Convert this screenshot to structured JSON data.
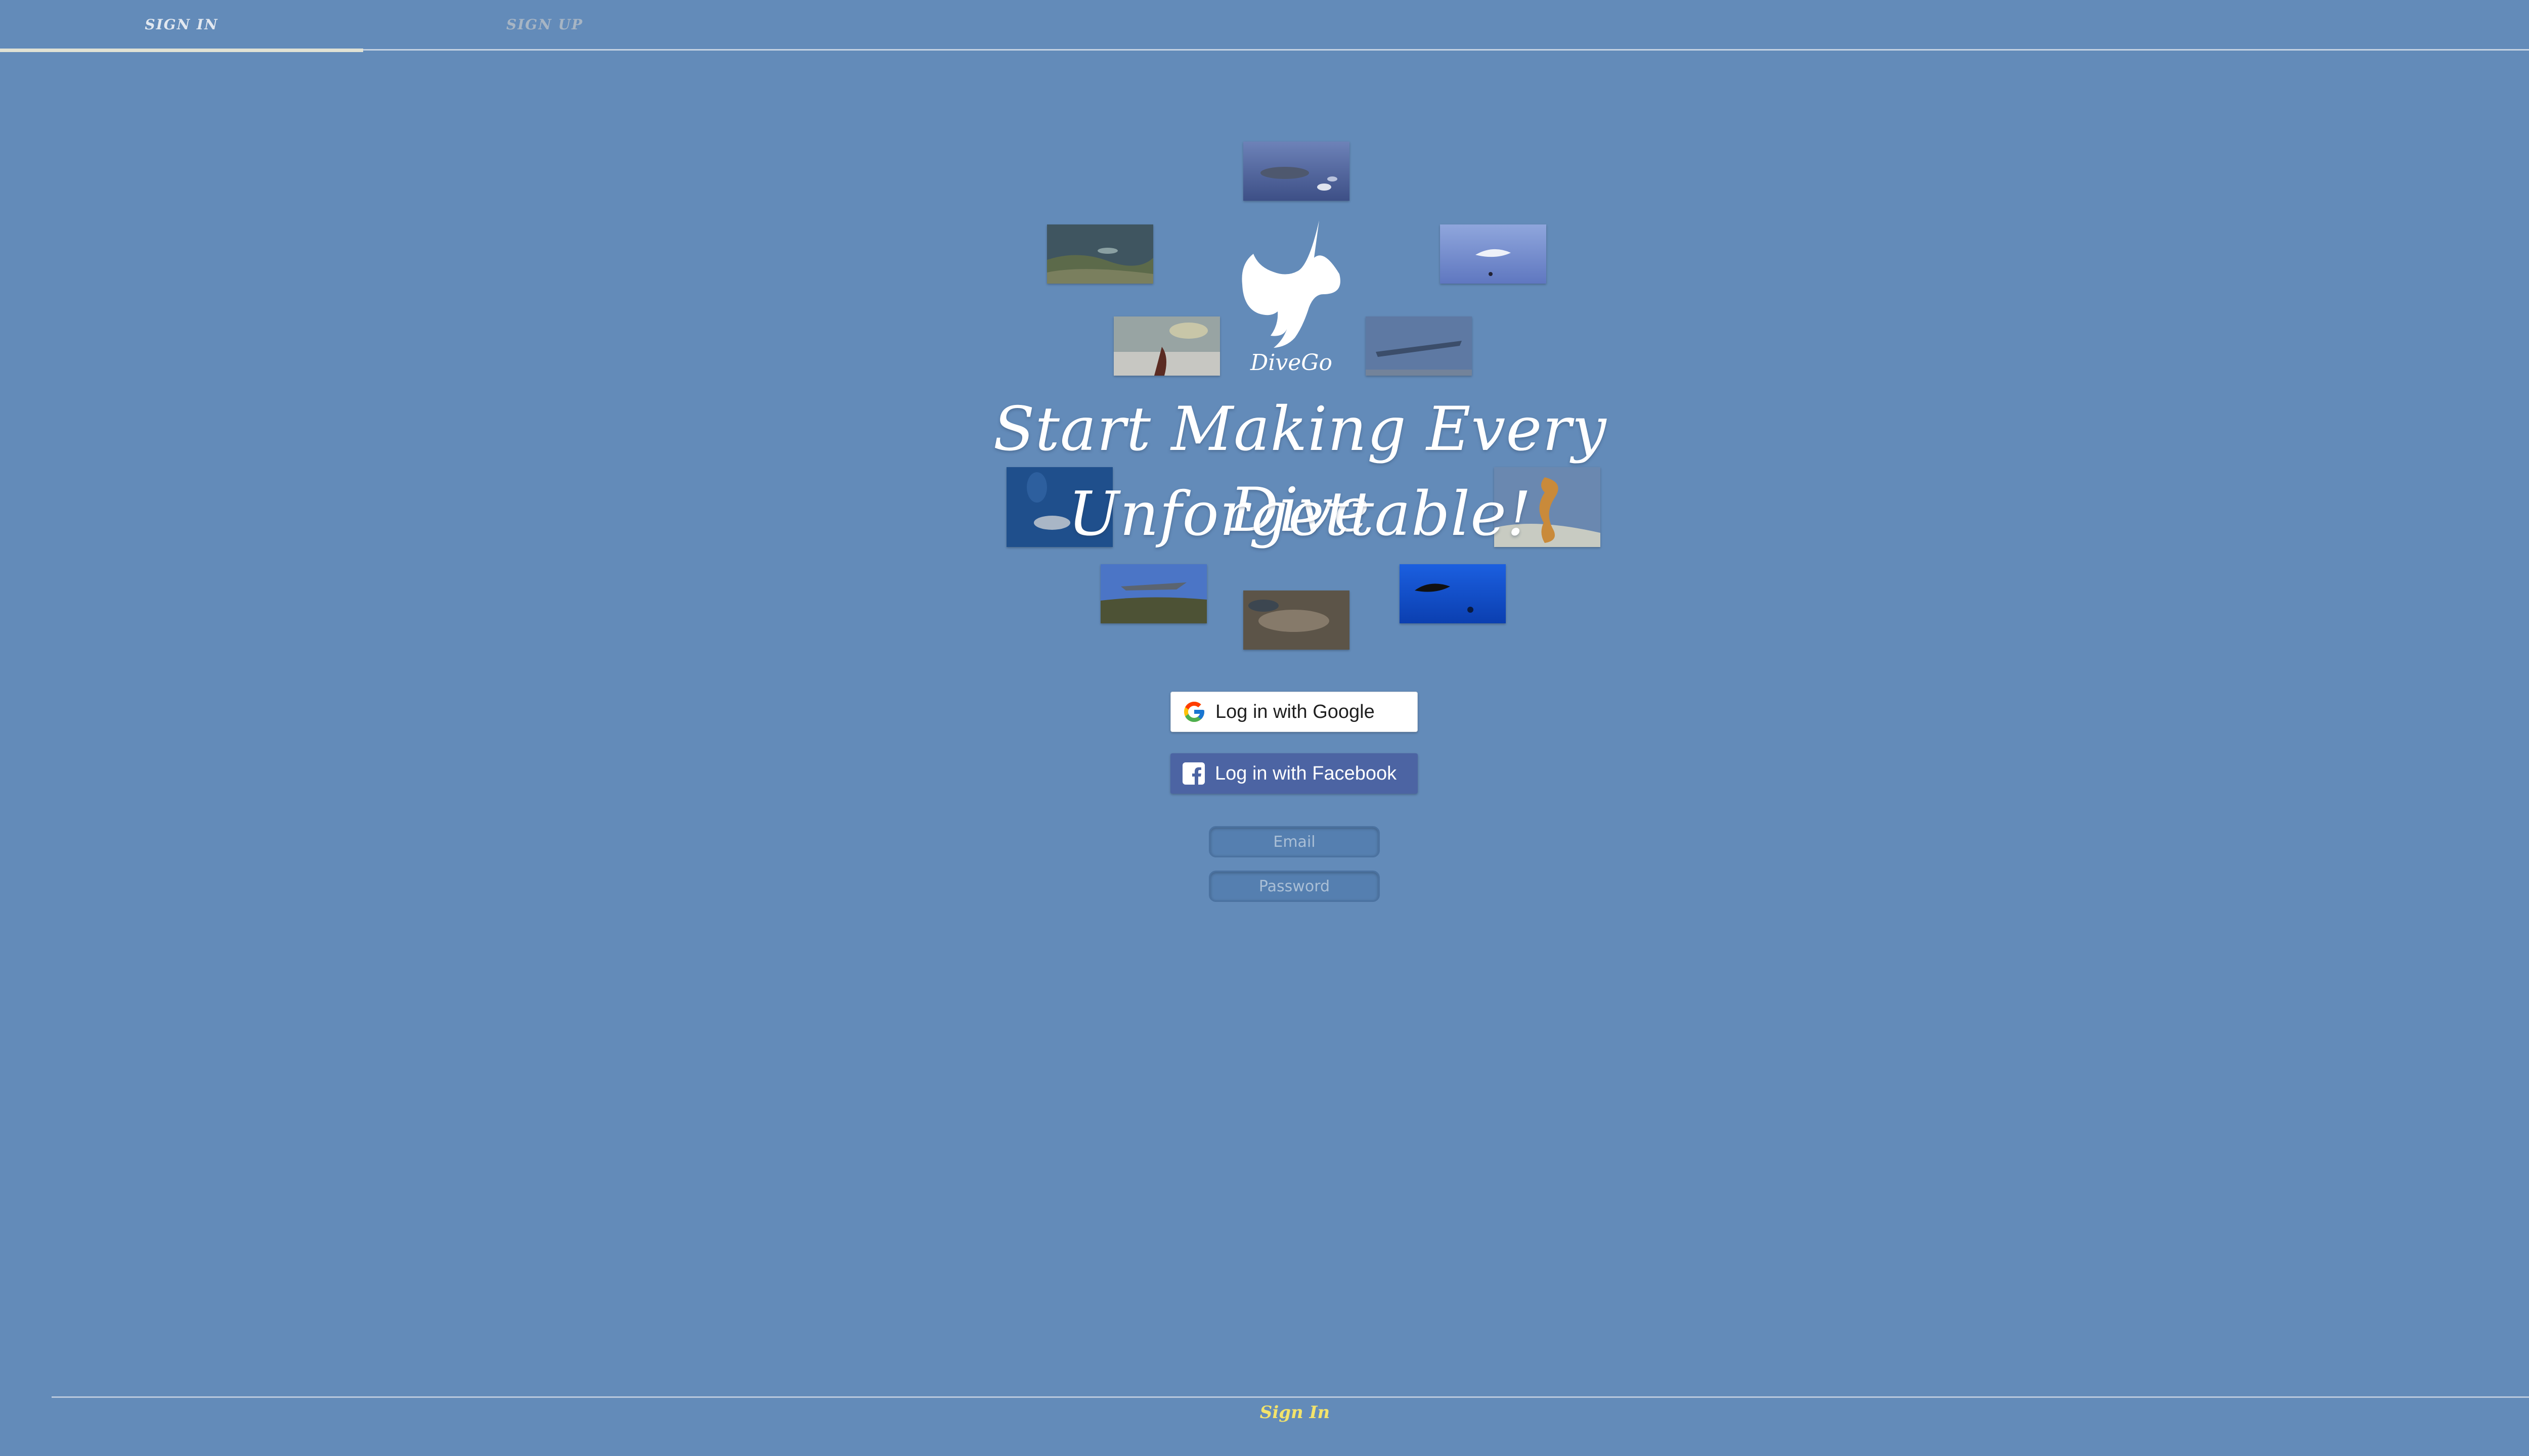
{
  "tabs": [
    {
      "label": "SIGN IN",
      "active": true
    },
    {
      "label": "SIGN UP",
      "active": false
    }
  ],
  "hero": {
    "brand": "DiveGo",
    "headline_line1": "Start Making Every Dive",
    "headline_line2": "Unforgettable!",
    "logo_icon": "manta-ray-icon"
  },
  "auth": {
    "google_label": "Log in with Google",
    "facebook_label": "Log in with Facebook",
    "email_placeholder": "Email",
    "password_placeholder": "Password"
  },
  "footer": {
    "link_label": "Sign In"
  },
  "colors": {
    "background": "#638bb9",
    "facebook": "#4c64a3",
    "footer_link": "#f3e36a"
  }
}
